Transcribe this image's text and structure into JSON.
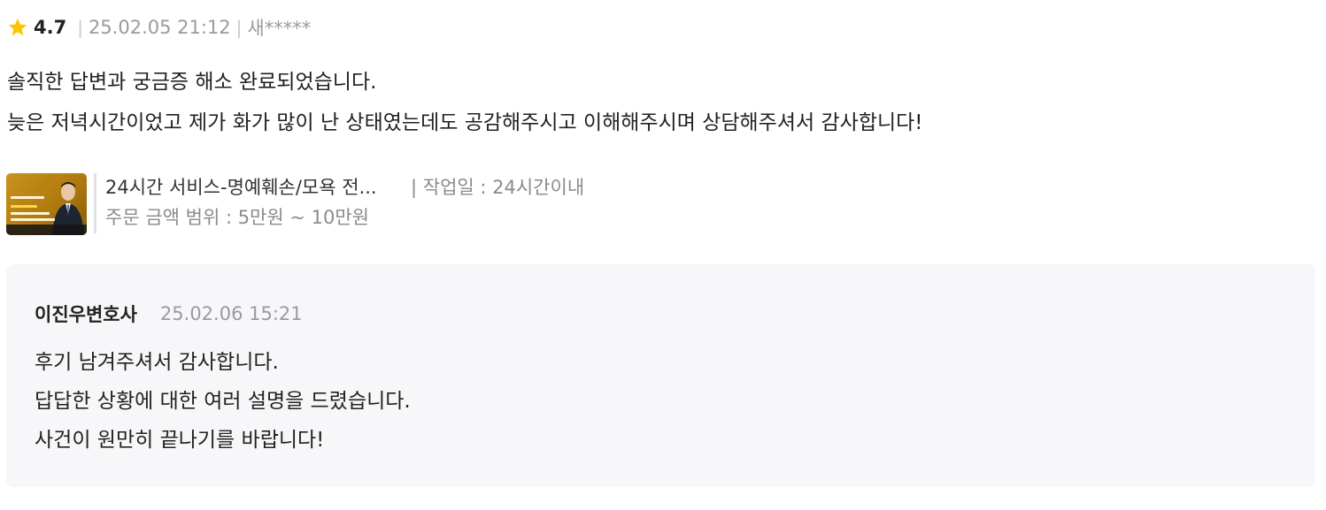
{
  "review": {
    "rating": "4.7",
    "date": "25.02.05 21:12",
    "author": "새*****",
    "separator": "|",
    "lines": [
      "솔직한 답변과 궁금증 해소 완료되었습니다.",
      "늦은 저녁시간이었고 제가 화가 많이 난 상태였는데도 공감해주시고 이해해주시며 상담해주셔서 감사합니다!"
    ],
    "star_icon": "star-icon",
    "star_color": "#FFC400"
  },
  "service": {
    "title": "24시간 서비스-명예훼손/모욕 전...",
    "work_period": "| 작업일 : 24시간이내",
    "price_range": "주문 금액 범위 : 5만원 ~ 10만원",
    "thumbnail_color": "#C08A17"
  },
  "reply": {
    "author": "이진우변호사",
    "date": "25.02.06 15:21",
    "lines": [
      "후기 남겨주셔서 감사합니다.",
      "답답한 상황에 대한 여러 설명을 드렸습니다.",
      "사건이 원만히 끝나기를 바랍니다!"
    ]
  }
}
